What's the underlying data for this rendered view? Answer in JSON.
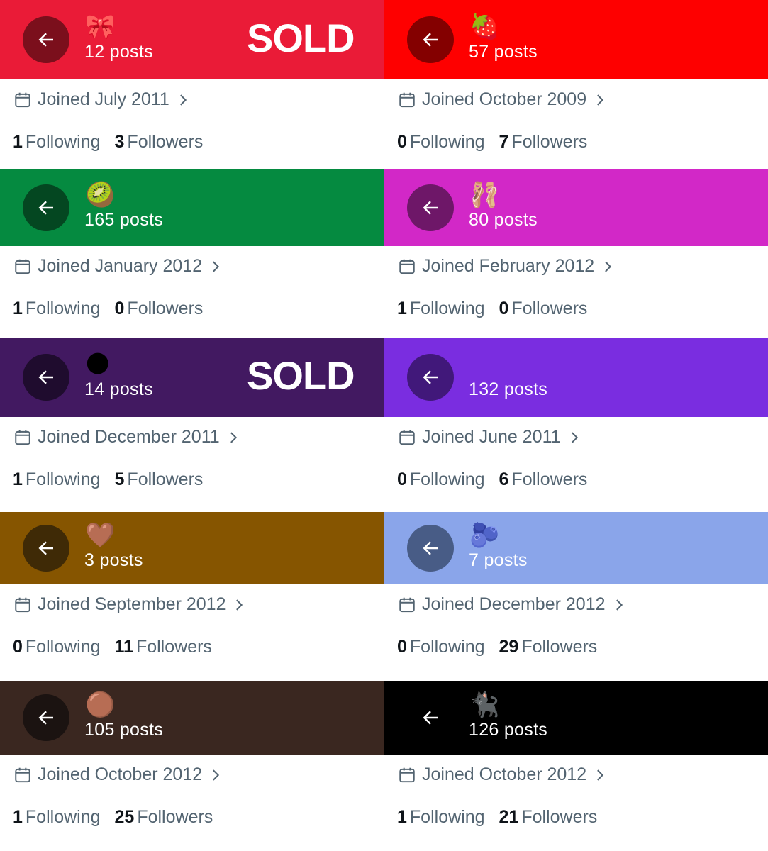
{
  "sold_label": "SOLD",
  "profiles": [
    {
      "color": "#ea1b37",
      "btn": "#7b0f1c",
      "emoji": "🎀",
      "posts": "12 posts",
      "sold": true,
      "joined": "Joined July 2011",
      "following": "1",
      "following_label": "Following",
      "followers": "3",
      "followers_label": "Followers"
    },
    {
      "color": "#fe0000",
      "btn": "#840000",
      "emoji": "🍓",
      "posts": "57 posts",
      "sold": false,
      "joined": "Joined October 2009",
      "following": "0",
      "following_label": "Following",
      "followers": "7",
      "followers_label": "Followers"
    },
    {
      "color": "#058a40",
      "btn": "#044721",
      "emoji": "🥝",
      "posts": "165 posts",
      "sold": false,
      "joined": "Joined January 2012",
      "following": "1",
      "following_label": "Following",
      "followers": "0",
      "followers_label": "Followers"
    },
    {
      "color": "#d228c7",
      "btn": "#6e1768",
      "emoji": "🩰",
      "posts": "80 posts",
      "sold": false,
      "joined": "Joined February 2012",
      "following": "1",
      "following_label": "Following",
      "followers": "0",
      "followers_label": "Followers"
    },
    {
      "color": "#421961",
      "btn": "#1f0c2e",
      "emoji": "🌑",
      "posts": "14 posts",
      "sold": true,
      "joined": "Joined December 2011",
      "following": "1",
      "following_label": "Following",
      "followers": "5",
      "followers_label": "Followers"
    },
    {
      "color": "#7a2de0",
      "btn": "#41187a",
      "emoji": "",
      "posts": "132 posts",
      "sold": false,
      "joined": "Joined June 2011",
      "following": "0",
      "following_label": "Following",
      "followers": "6",
      "followers_label": "Followers"
    },
    {
      "color": "#865500",
      "btn": "#3f2a06",
      "emoji": "🤎",
      "posts": "3 posts",
      "sold": false,
      "joined": "Joined September 2012",
      "following": "0",
      "following_label": "Following",
      "followers": "11",
      "followers_label": "Followers"
    },
    {
      "color": "#8aa5ea",
      "btn": "#485c86",
      "emoji": "🫐",
      "posts": "7 posts",
      "sold": true,
      "joined": "Joined December 2012",
      "following": "0",
      "following_label": "Following",
      "followers": "29",
      "followers_label": "Followers"
    },
    {
      "color": "#3a2720",
      "btn": "#1b1311",
      "emoji": "🟤",
      "posts": "105 posts",
      "sold": false,
      "joined": "Joined October 2012",
      "following": "1",
      "following_label": "Following",
      "followers": "25",
      "followers_label": "Followers"
    },
    {
      "color": "#000000",
      "btn": "#000000",
      "emoji": "🐈‍⬛",
      "posts": "126 posts",
      "sold": true,
      "joined": "Joined October 2012",
      "following": "1",
      "following_label": "Following",
      "followers": "21",
      "followers_label": "Followers"
    }
  ]
}
